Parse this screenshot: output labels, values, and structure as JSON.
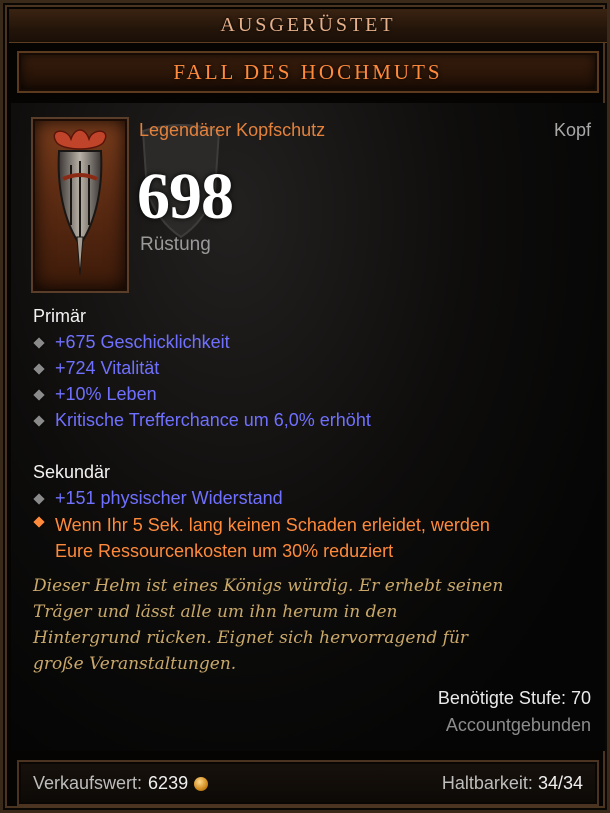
{
  "header": {
    "status": "AUSGERÜSTET",
    "item_name": "FALL DES HOCHMUTS"
  },
  "item": {
    "type": "Legendärer Kopfschutz",
    "slot": "Kopf",
    "armor_value": "698",
    "armor_label": "Rüstung",
    "icon": "legendary-helm-icon"
  },
  "primary": {
    "title": "Primär",
    "stats": [
      "+675 Geschicklichkeit",
      "+724 Vitalität",
      "+10% Leben",
      "Kritische Trefferchance um 6,0% erhöht"
    ]
  },
  "secondary": {
    "title": "Sekundär",
    "stats": [
      "+151 physischer Widerstand"
    ],
    "legendary_line1": "Wenn Ihr 5 Sek. lang keinen Schaden erleidet, werden",
    "legendary_line2": "Eure Ressourcenkosten um 30% reduziert"
  },
  "flavor": {
    "line1": "Dieser Helm ist eines Königs würdig. Er erhebt seinen",
    "line2": "Träger und lässt alle um ihn herum in den",
    "line3": "Hintergrund rücken. Eignet sich hervorragend für",
    "line4": "große Veranstaltungen."
  },
  "requirements": {
    "level": "Benötigte Stufe: 70",
    "binding": "Accountgebunden"
  },
  "footer": {
    "sell_label": "Verkaufswert:",
    "sell_value": "6239",
    "durability_label": "Haltbarkeit:",
    "durability_value": "34/34"
  },
  "colors": {
    "legendary": "#ff8a3c",
    "magic": "#7070ff",
    "flavor": "#c9a86a"
  }
}
